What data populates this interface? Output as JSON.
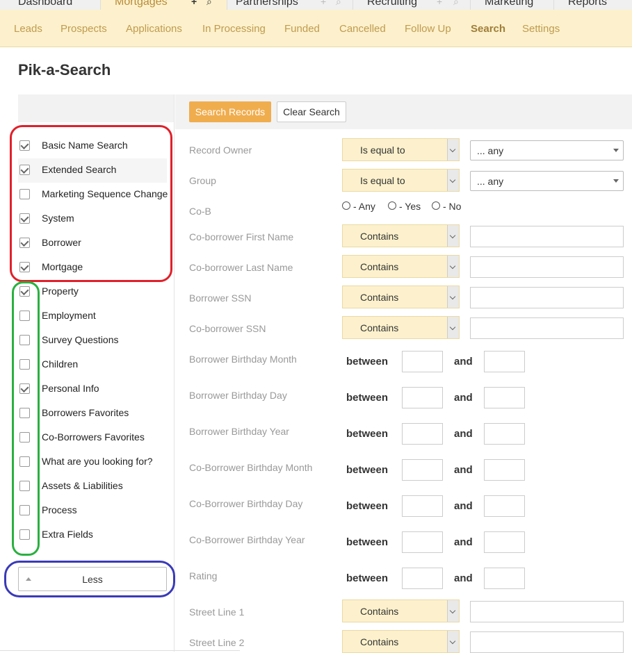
{
  "top_tabs": [
    "Dashboard",
    "Mortgages",
    "Partnerships",
    "Recruiting",
    "Marketing",
    "Reports"
  ],
  "sub_nav": [
    "Leads",
    "Prospects",
    "Applications",
    "In Processing",
    "Funded",
    "Cancelled",
    "Follow Up",
    "Search",
    "Settings"
  ],
  "sub_nav_active": "Search",
  "page_title": "Pik-a-Search",
  "buttons": {
    "search": "Search Records",
    "clear": "Clear Search",
    "less": "Less"
  },
  "sections": [
    {
      "label": "Basic Name Search",
      "checked": true
    },
    {
      "label": "Extended Search",
      "checked": true
    },
    {
      "label": "Marketing Sequence Change",
      "checked": false
    },
    {
      "label": "System",
      "checked": true
    },
    {
      "label": "Borrower",
      "checked": true
    },
    {
      "label": "Mortgage",
      "checked": true
    },
    {
      "label": "Property",
      "checked": true
    },
    {
      "label": "Employment",
      "checked": false
    },
    {
      "label": "Survey Questions",
      "checked": false
    },
    {
      "label": "Children",
      "checked": false
    },
    {
      "label": "Personal Info",
      "checked": true
    },
    {
      "label": "Borrowers Favorites",
      "checked": false
    },
    {
      "label": "Co-Borrowers Favorites",
      "checked": false
    },
    {
      "label": "What are you looking for?",
      "checked": false
    },
    {
      "label": "Assets & Liabilities",
      "checked": false
    },
    {
      "label": "Process",
      "checked": false
    },
    {
      "label": "Extra Fields",
      "checked": false
    }
  ],
  "fields": {
    "record_owner": {
      "label": "Record Owner",
      "operator": "Is equal to",
      "value": "... any"
    },
    "group": {
      "label": "Group",
      "operator": "Is equal to",
      "value": "... any"
    },
    "cob": {
      "label": "Co-B",
      "options": [
        "- Any",
        "- Yes",
        "- No"
      ]
    },
    "cob_first": {
      "label": "Co-borrower First Name",
      "operator": "Contains"
    },
    "cob_last": {
      "label": "Co-borrower Last Name",
      "operator": "Contains"
    },
    "borrower_ssn": {
      "label": "Borrower SSN",
      "operator": "Contains"
    },
    "cob_ssn": {
      "label": "Co-borrower SSN",
      "operator": "Contains"
    },
    "street1": {
      "label": "Street Line 1",
      "operator": "Contains"
    },
    "street2": {
      "label": "Street Line 2",
      "operator": "Contains"
    }
  },
  "range_fields": [
    {
      "label": "Borrower Birthday Month"
    },
    {
      "label": "Borrower Birthday Day"
    },
    {
      "label": "Borrower Birthday Year"
    },
    {
      "label": "Co-Borrower Birthday Month"
    },
    {
      "label": "Co-Borrower Birthday Day"
    },
    {
      "label": "Co-Borrower Birthday Year"
    },
    {
      "label": "Rating"
    }
  ],
  "range_words": {
    "between": "between",
    "and": "and"
  },
  "annotation_colors": {
    "red": "#e0202a",
    "green": "#2ab040",
    "blue": "#3a3ab8"
  }
}
